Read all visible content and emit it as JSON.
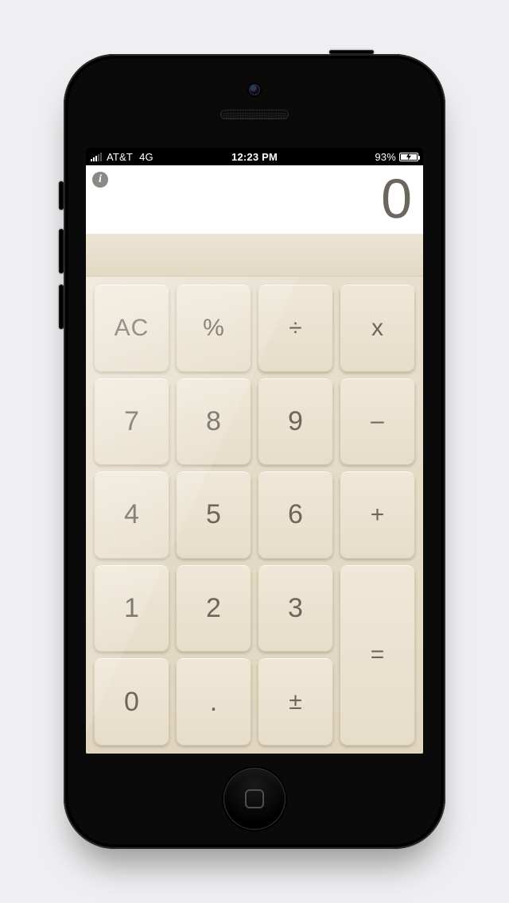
{
  "statusbar": {
    "carrier": "AT&T",
    "network": "4G",
    "time": "12:23 PM",
    "battery_pct": "93%"
  },
  "display": {
    "value": "0"
  },
  "keys": {
    "ac": "AC",
    "pct": "%",
    "div": "÷",
    "mul": "x",
    "k7": "7",
    "k8": "8",
    "k9": "9",
    "sub": "–",
    "k4": "4",
    "k5": "5",
    "k6": "6",
    "add": "+",
    "k1": "1",
    "k2": "2",
    "k3": "3",
    "eq": "=",
    "k0": "0",
    "dot": ".",
    "pm": "±"
  }
}
